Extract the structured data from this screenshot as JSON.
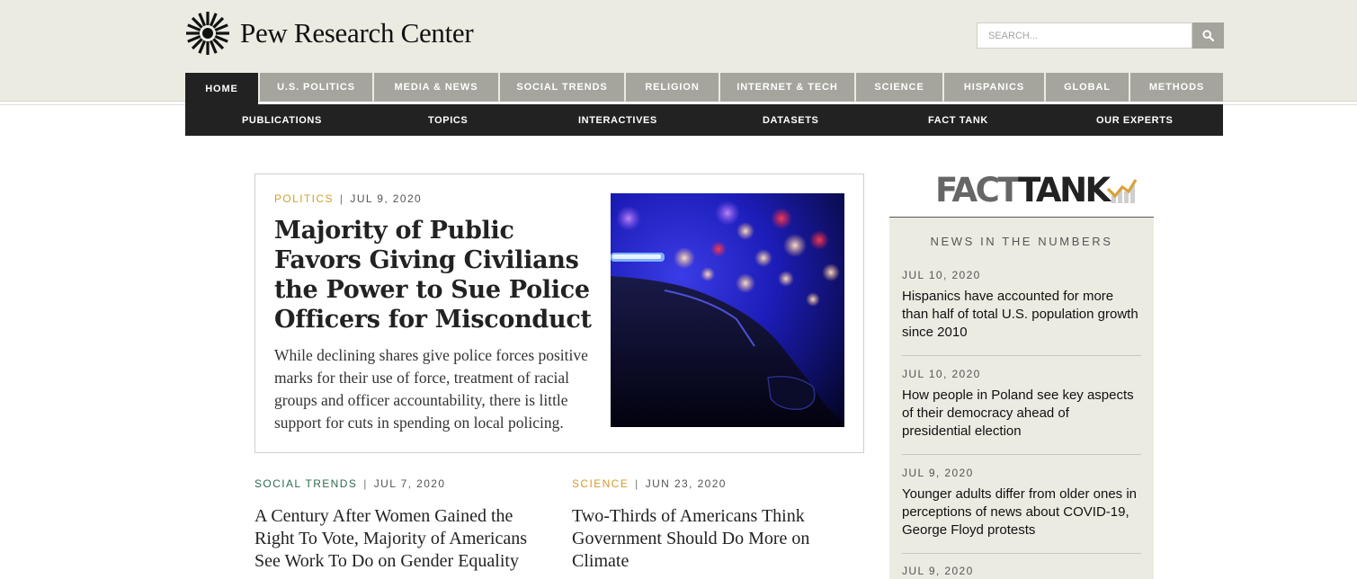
{
  "brand": {
    "name": "Pew Research Center"
  },
  "search": {
    "placeholder": "SEARCH..."
  },
  "primary_nav": [
    {
      "label": "HOME",
      "active": true
    },
    {
      "label": "U.S. POLITICS"
    },
    {
      "label": "MEDIA & NEWS"
    },
    {
      "label": "SOCIAL TRENDS"
    },
    {
      "label": "RELIGION"
    },
    {
      "label": "INTERNET & TECH"
    },
    {
      "label": "SCIENCE"
    },
    {
      "label": "HISPANICS"
    },
    {
      "label": "GLOBAL"
    },
    {
      "label": "METHODS"
    }
  ],
  "secondary_nav": [
    {
      "label": "PUBLICATIONS"
    },
    {
      "label": "TOPICS"
    },
    {
      "label": "INTERACTIVES"
    },
    {
      "label": "DATASETS"
    },
    {
      "label": "FACT TANK"
    },
    {
      "label": "OUR EXPERTS"
    }
  ],
  "featured": {
    "category": "POLITICS",
    "date": "JUL 9, 2020",
    "title": "Majority of Public Favors Giving Civilians the Power to Sue Police Officers for Misconduct",
    "summary": "While declining shares give police forces positive marks for their use of force, treatment of racial groups and officer accountability, there is little support for cuts in spending on local policing."
  },
  "stories": [
    {
      "category": "SOCIAL TRENDS",
      "date": "JUL 7, 2020",
      "title": "A Century After Women Gained the Right To Vote, Majority of Americans See Work To Do on Gender Equality"
    },
    {
      "category": "SCIENCE",
      "date": "JUN 23, 2020",
      "title": "Two-Thirds of Americans Think Government Should Do More on Climate"
    }
  ],
  "fact_tank": {
    "logo_fact": "FACT",
    "logo_tank": "TANK",
    "heading": "NEWS IN THE NUMBERS",
    "items": [
      {
        "date": "JUL 10, 2020",
        "title": "Hispanics have accounted for more than half of total U.S. population growth since 2010"
      },
      {
        "date": "JUL 10, 2020",
        "title": "How people in Poland see key aspects of their democracy ahead of presidential election"
      },
      {
        "date": "JUL 9, 2020",
        "title": "Younger adults differ from older ones in perceptions of news about COVID-19, George Floyd protests"
      },
      {
        "date": "JUL 9, 2020"
      }
    ]
  },
  "colors": {
    "header_bg": "#ecebe2",
    "nav_tab": "#a5a59e",
    "nav_active": "#222222",
    "category_politics": "#d1a12f",
    "category_social": "#2e6a4f",
    "category_science": "#d49a2b",
    "fact_tank_accent": "#d9a23a"
  }
}
